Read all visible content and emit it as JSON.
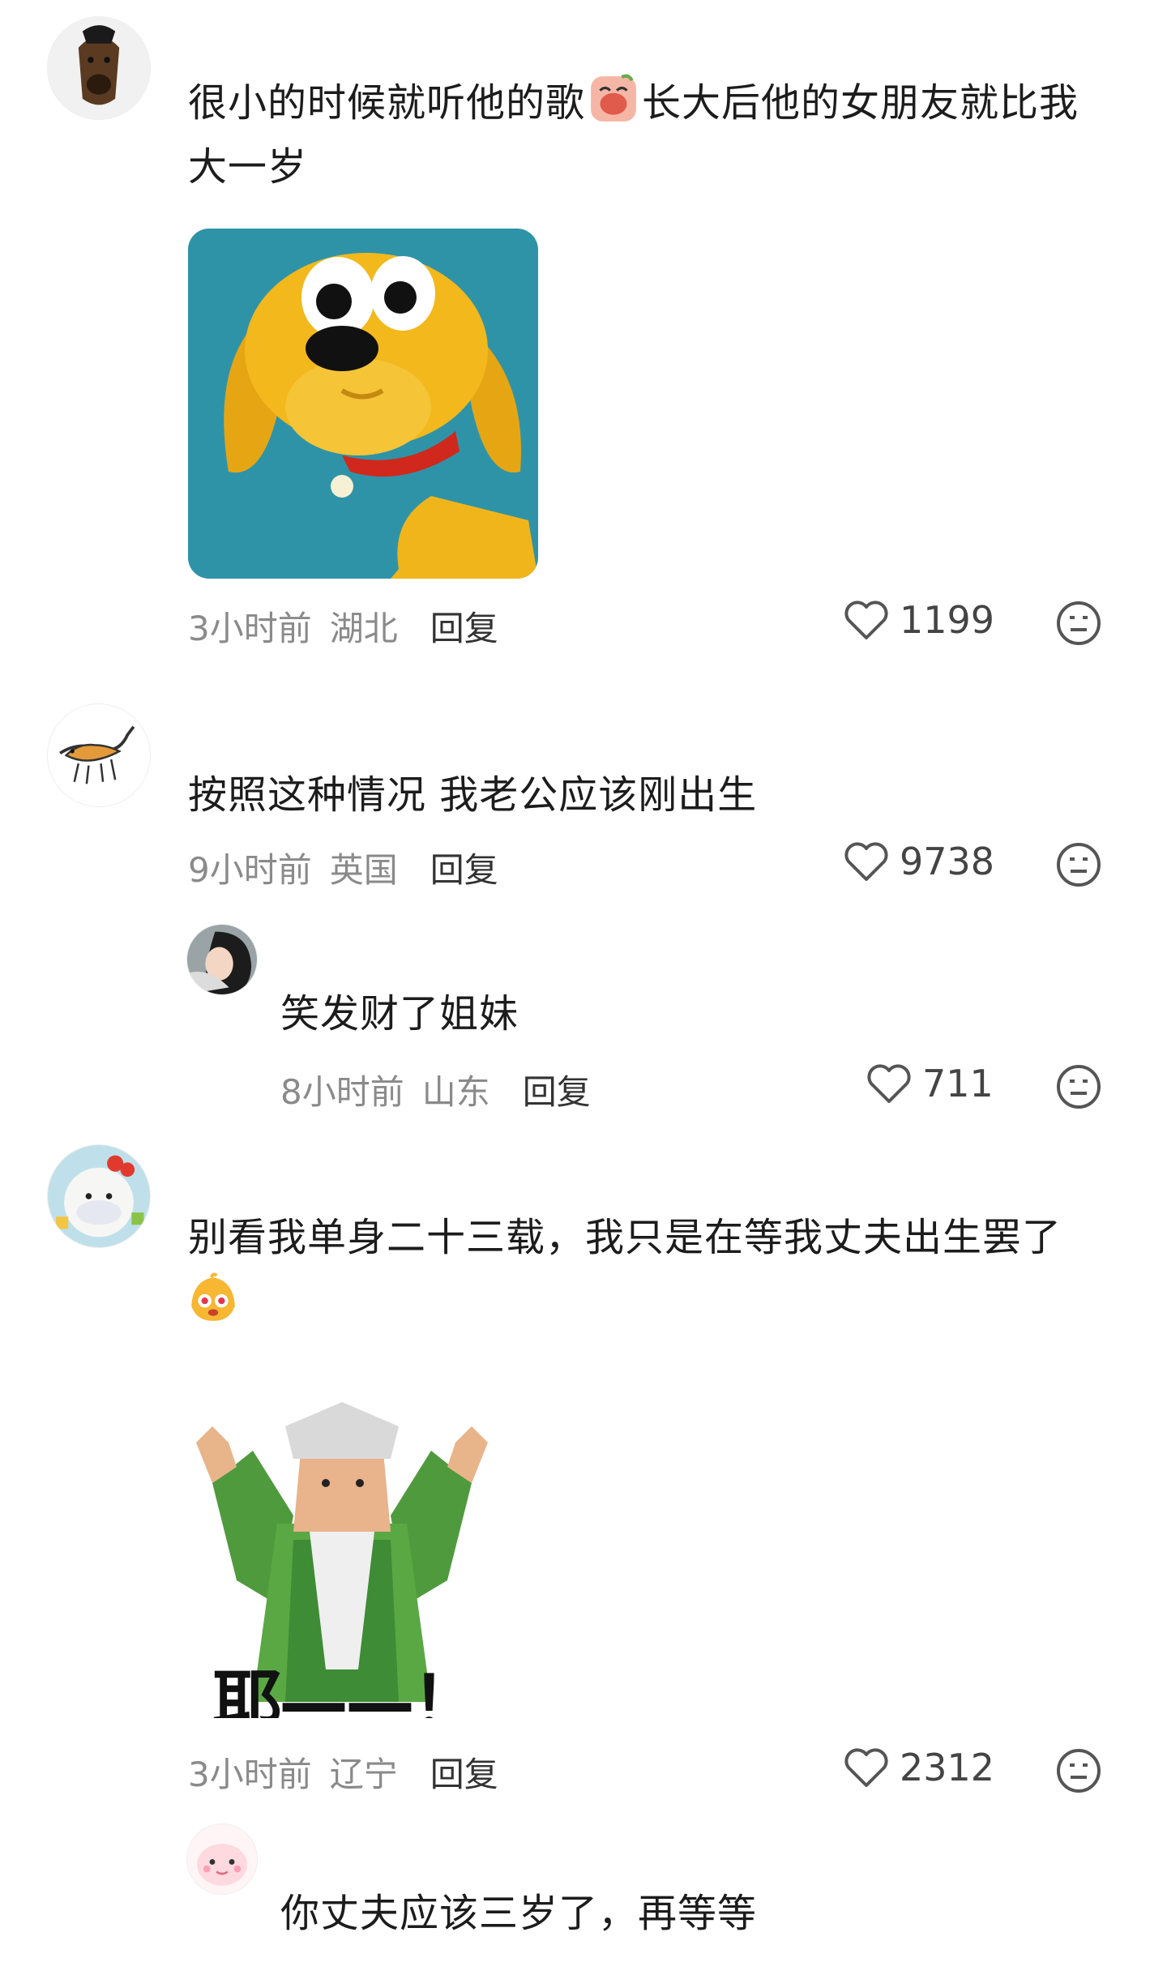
{
  "comments": [
    {
      "text_a": "很小的时候就听他的歌",
      "emoji_inline": "crying-face-emoji",
      "text_b": "长大后他的女朋友就比我",
      "text_c": "大一岁",
      "sticker": "yellow-cartoon-dog-sticker",
      "time": "3小时前",
      "location": "湖北",
      "reply_label": "回复",
      "likes": "1199"
    },
    {
      "text": "按照这种情况 我老公应该刚出生",
      "time": "9小时前",
      "location": "英国",
      "reply_label": "回复",
      "likes": "9738"
    },
    {
      "text": "笑发财了姐妹",
      "time": "8小时前",
      "location": "山东",
      "reply_label": "回复",
      "likes": "711"
    },
    {
      "text": "别看我单身二十三载，我只是在等我丈夫出生罢了",
      "emoji_inline": "starry-eyes-emoji",
      "sticker": "old-man-cheering-sticker",
      "sticker_caption": "耶——！",
      "time": "3小时前",
      "location": "辽宁",
      "reply_label": "回复",
      "likes": "2312"
    },
    {
      "text": "你丈夫应该三岁了，再等等"
    }
  ],
  "colors": {
    "meta_text": "#8a8a8a",
    "reply_text": "#333333",
    "body_text": "#1c1c1c",
    "sticker_bg": "#2f93a8",
    "dog_yellow": "#f2b81c"
  }
}
